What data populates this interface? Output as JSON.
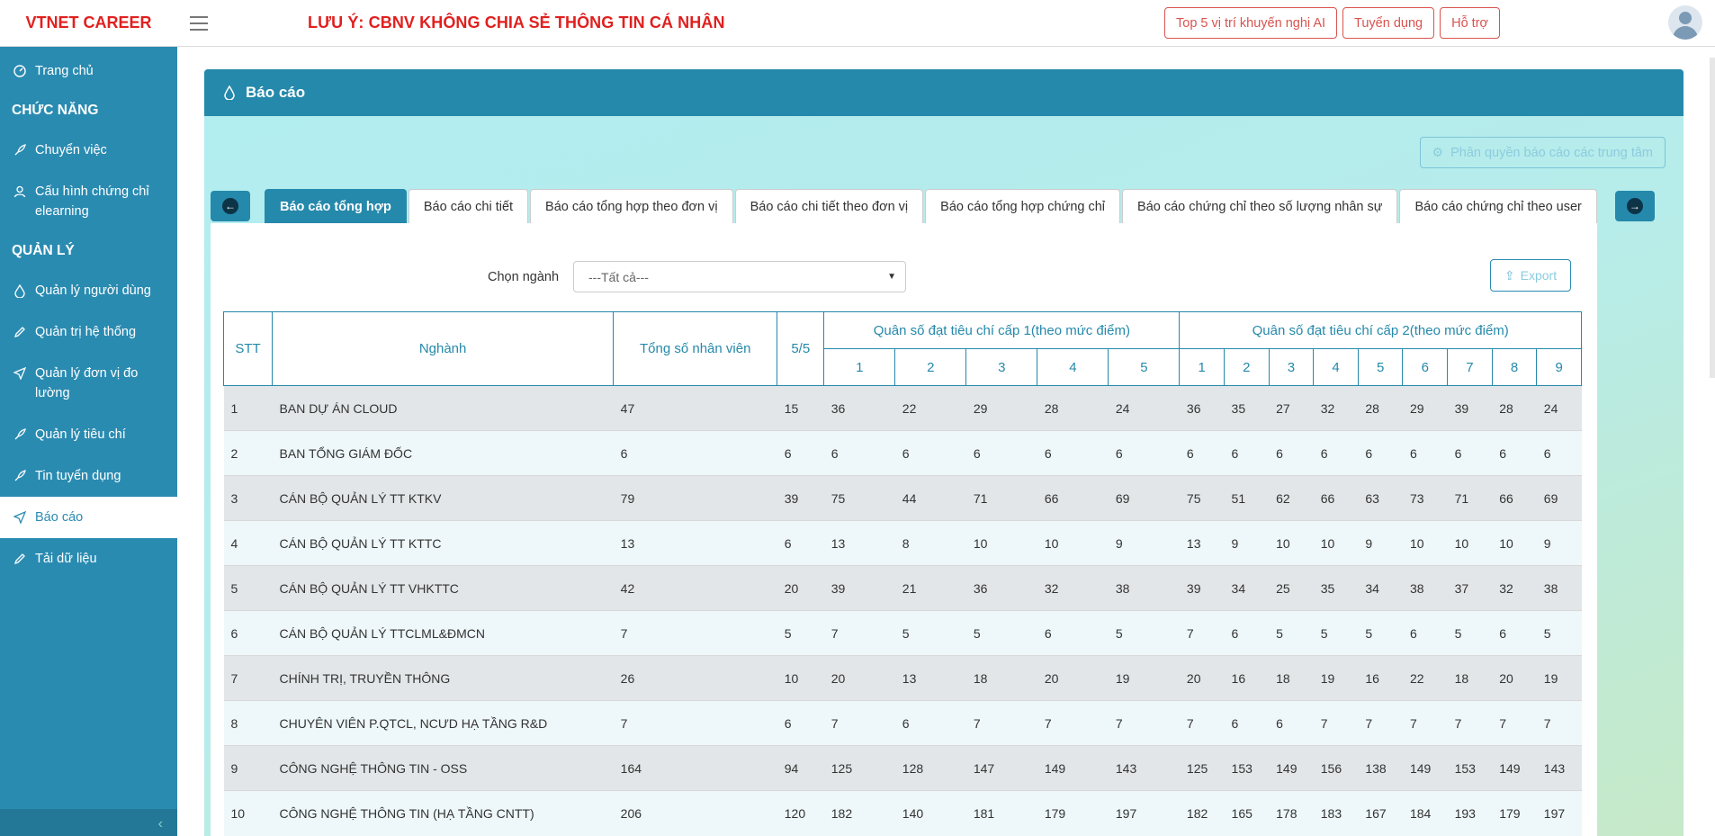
{
  "app": {
    "brand": "VTNET CAREER"
  },
  "header": {
    "notice": "LƯU Ý: CBNV KHÔNG CHIA SẺ THÔNG TIN CÁ NHÂN",
    "buttons": [
      "Top 5 vị trí khuyến nghị AI",
      "Tuyển dụng",
      "Hỗ trợ"
    ]
  },
  "sidebar": {
    "home": "Trang chủ",
    "section_functions": "CHỨC NĂNG",
    "transfer": "Chuyển việc",
    "config_cert": "Cấu hình chứng chỉ elearning",
    "section_manage": "QUẢN LÝ",
    "users": "Quản lý người dùng",
    "system": "Quản trị hệ thống",
    "units": "Quản lý đơn vị đo lường",
    "criteria": "Quản lý tiêu chí",
    "jobs": "Tin tuyển dụng",
    "reports": "Báo cáo",
    "upload": "Tải dữ liệu"
  },
  "card": {
    "title": "Báo cáo",
    "permission_button": "Phân quyền báo cáo các trung tâm"
  },
  "tabs": [
    "Báo cáo tổng hợp",
    "Báo cáo chi tiết",
    "Báo cáo tổng hợp theo đơn vị",
    "Báo cáo chi tiết theo đơn vị",
    "Báo cáo tổng hợp chứng chỉ",
    "Báo cáo chứng chỉ theo số lượng nhân sự",
    "Báo cáo chứng chỉ theo user"
  ],
  "filter": {
    "label": "Chọn ngành",
    "value": "---Tất cả---"
  },
  "export_label": "Export",
  "table": {
    "col_stt": "STT",
    "col_industry": "Nghành",
    "col_total": "Tổng số nhân viên",
    "col_55": "5/5",
    "group1": "Quân số đạt tiêu chí cấp 1(theo mức điểm)",
    "group2": "Quân số đạt tiêu chí cấp 2(theo mức điểm)",
    "group1_levels": [
      "1",
      "2",
      "3",
      "4",
      "5"
    ],
    "group2_levels": [
      "1",
      "2",
      "3",
      "4",
      "5",
      "6",
      "7",
      "8",
      "9"
    ],
    "rows": [
      [
        "1",
        "BAN DỰ ÁN CLOUD",
        "47",
        "15",
        "36",
        "22",
        "29",
        "28",
        "24",
        "36",
        "35",
        "27",
        "32",
        "28",
        "29",
        "39",
        "28",
        "24"
      ],
      [
        "2",
        "BAN TỔNG GIÁM ĐỐC",
        "6",
        "6",
        "6",
        "6",
        "6",
        "6",
        "6",
        "6",
        "6",
        "6",
        "6",
        "6",
        "6",
        "6",
        "6",
        "6"
      ],
      [
        "3",
        "CÁN BỘ QUẢN LÝ TT KTKV",
        "79",
        "39",
        "75",
        "44",
        "71",
        "66",
        "69",
        "75",
        "51",
        "62",
        "66",
        "63",
        "73",
        "71",
        "66",
        "69"
      ],
      [
        "4",
        "CÁN BỘ QUẢN LÝ TT KTTC",
        "13",
        "6",
        "13",
        "8",
        "10",
        "10",
        "9",
        "13",
        "9",
        "10",
        "10",
        "9",
        "10",
        "10",
        "10",
        "9"
      ],
      [
        "5",
        "CÁN BỘ QUẢN LÝ TT VHKTTC",
        "42",
        "20",
        "39",
        "21",
        "36",
        "32",
        "38",
        "39",
        "34",
        "25",
        "35",
        "34",
        "38",
        "37",
        "32",
        "38"
      ],
      [
        "6",
        "CÁN BỘ QUẢN LÝ TTCLML&ĐMCN",
        "7",
        "5",
        "7",
        "5",
        "5",
        "6",
        "5",
        "7",
        "6",
        "5",
        "5",
        "5",
        "6",
        "5",
        "6",
        "5"
      ],
      [
        "7",
        "CHÍNH TRỊ, TRUYỀN THÔNG",
        "26",
        "10",
        "20",
        "13",
        "18",
        "20",
        "19",
        "20",
        "16",
        "18",
        "19",
        "16",
        "22",
        "18",
        "20",
        "19"
      ],
      [
        "8",
        "CHUYÊN VIÊN P.QTCL, NCƯD HẠ TẦNG R&D",
        "7",
        "6",
        "7",
        "6",
        "7",
        "7",
        "7",
        "7",
        "6",
        "6",
        "7",
        "7",
        "7",
        "7",
        "7",
        "7"
      ],
      [
        "9",
        "CÔNG NGHỆ THÔNG TIN - OSS",
        "164",
        "94",
        "125",
        "128",
        "147",
        "149",
        "143",
        "125",
        "153",
        "149",
        "156",
        "138",
        "149",
        "153",
        "149",
        "143"
      ],
      [
        "10",
        "CÔNG NGHỆ THÔNG TIN (HẠ TẦNG CNTT)",
        "206",
        "120",
        "182",
        "140",
        "181",
        "179",
        "197",
        "182",
        "165",
        "178",
        "183",
        "167",
        "184",
        "193",
        "179",
        "197"
      ]
    ]
  }
}
